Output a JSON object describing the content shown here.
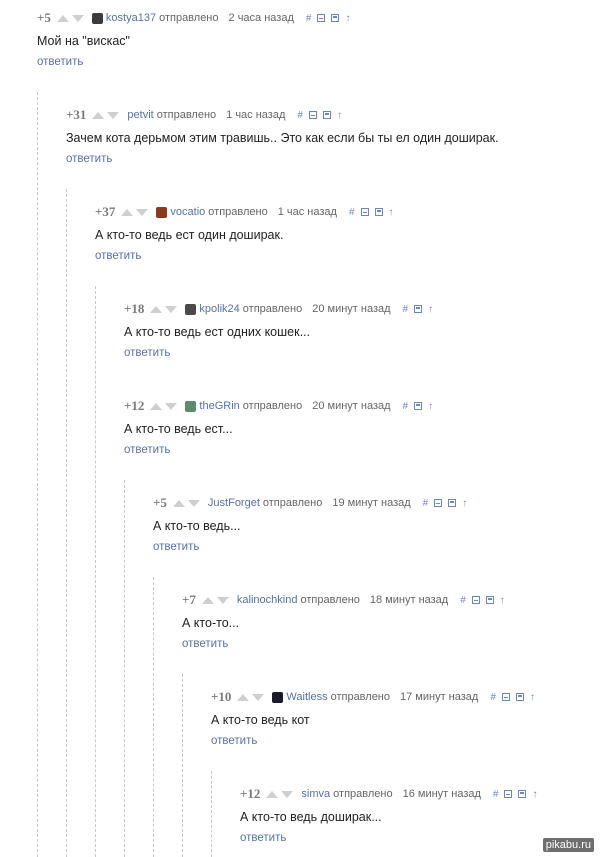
{
  "labels": {
    "sent": "отправлено",
    "reply": "ответить"
  },
  "comments": [
    {
      "rating": "+5",
      "nick": "kostya137",
      "time": "2 часа назад",
      "text": "Мой на \"вискас\"",
      "avatar_color": "#3b3b3b"
    },
    {
      "rating": "+31",
      "nick": "petvit",
      "time": "1 час назад",
      "text": "Зачем кота дерьмом этим травишь.. Это как если бы ты ел один доширак.",
      "avatar_color": ""
    },
    {
      "rating": "+37",
      "nick": "vocatio",
      "time": "1 час назад",
      "text": "А кто-то ведь ест один доширак.",
      "avatar_color": "#8a3b1f"
    },
    {
      "rating": "+18",
      "nick": "kpolik24",
      "time": "20 минут назад",
      "text": "А кто-то ведь ест одних кошек...",
      "avatar_color": "#4a4a4a"
    },
    {
      "rating": "+12",
      "nick": "theGRin",
      "time": "20 минут назад",
      "text": "А кто-то ведь ест...",
      "avatar_color": "#5d8c6a"
    },
    {
      "rating": "+5",
      "nick": "JustForget",
      "time": "19 минут назад",
      "text": "А кто-то ведь...",
      "avatar_color": ""
    },
    {
      "rating": "+7",
      "nick": "kalinochkind",
      "time": "18 минут назад",
      "text": "А кто-то...",
      "avatar_color": ""
    },
    {
      "rating": "+10",
      "nick": "Waitless",
      "time": "17 минут назад",
      "text": "А кто-то ведь кот",
      "avatar_color": "#1a1a2e"
    },
    {
      "rating": "+12",
      "nick": "simva",
      "time": "16 минут назад",
      "text": "А кто-то ведь доширак...",
      "avatar_color": ""
    }
  ],
  "watermark": "pikabu.ru"
}
